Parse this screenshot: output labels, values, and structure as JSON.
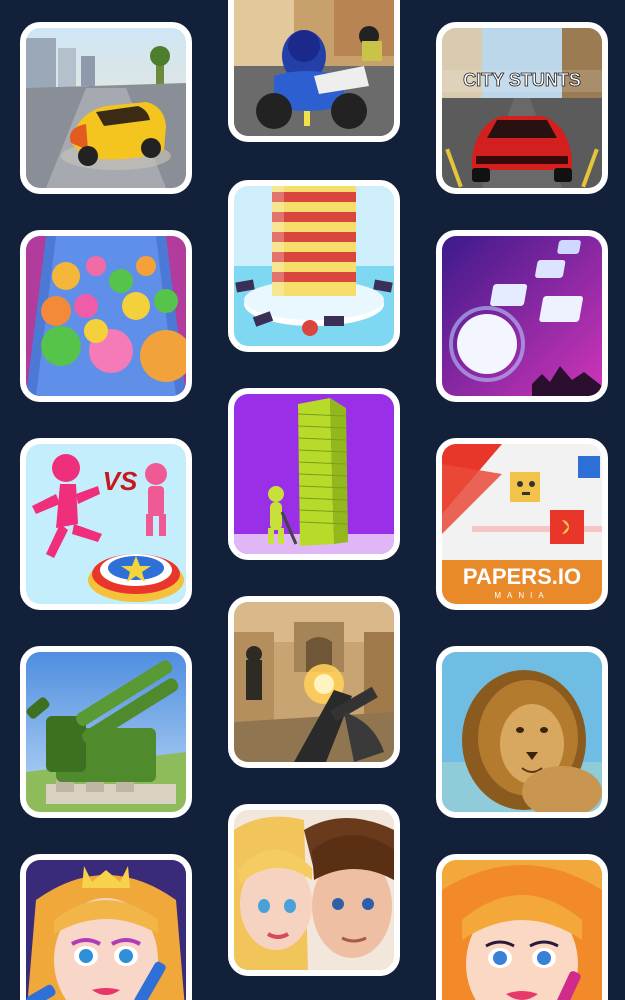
{
  "tiles": [
    {
      "id": "car-drift",
      "icon": "sports-car-icon"
    },
    {
      "id": "moto-race",
      "icon": "motorcycle-icon"
    },
    {
      "id": "city-stunts",
      "icon": "red-supercar-icon",
      "text": "CITY STUNTS"
    },
    {
      "id": "helix-tower",
      "icon": "striped-tower-icon"
    },
    {
      "id": "color-balls",
      "icon": "balls-icon"
    },
    {
      "id": "piano-tiles",
      "icon": "neon-tiles-icon"
    },
    {
      "id": "stickman-vs",
      "icon": "stickman-icon",
      "text": "VS"
    },
    {
      "id": "tall-tower",
      "icon": "green-tower-icon"
    },
    {
      "id": "papers-io",
      "icon": "paper-cube-icon",
      "text": "PAPERS.IO",
      "subtext": "MANIA"
    },
    {
      "id": "army-cannon",
      "icon": "cannon-icon"
    },
    {
      "id": "fps-shooter",
      "icon": "rifle-icon"
    },
    {
      "id": "lion-sim",
      "icon": "lion-icon"
    },
    {
      "id": "princess-makeup",
      "icon": "princess-icon"
    },
    {
      "id": "couple-dressup",
      "icon": "couple-icon"
    },
    {
      "id": "makeup-girl",
      "icon": "girl-face-icon"
    }
  ],
  "colors": {
    "background": "#13203a",
    "tile_border": "#ffffff"
  }
}
